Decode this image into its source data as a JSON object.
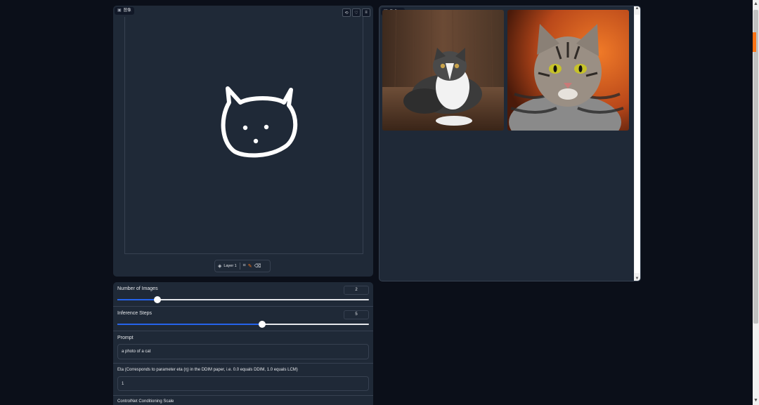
{
  "editor": {
    "label": "图像",
    "tools": {
      "undo": "⟲",
      "heart": "♡",
      "menu": "≡"
    },
    "layer_label": "Layer 1"
  },
  "gallery": {
    "label": "Gallery",
    "images": [
      "cat-sitting-photo",
      "tabby-cat-portrait"
    ]
  },
  "controls": {
    "num_images": {
      "label": "Number of Images",
      "value": "2",
      "fraction": 0.16
    },
    "steps": {
      "label": "Inference Steps",
      "value": "5",
      "fraction": 0.575
    },
    "prompt": {
      "label": "Prompt",
      "value": "a photo of a cat"
    },
    "eta": {
      "label": "Eta (Corresponds to parameter eta (η) in the DDIM paper, i.e. 0.0 equals DDIM, 1.0 equals LCM)",
      "value": "1"
    },
    "controlnet": {
      "label": "ControlNet Conditioning Scale"
    }
  },
  "colors": {
    "accent": "#2563eb",
    "orange": "#f97316",
    "panel": "#1f2937",
    "bg": "#0b0f19"
  }
}
